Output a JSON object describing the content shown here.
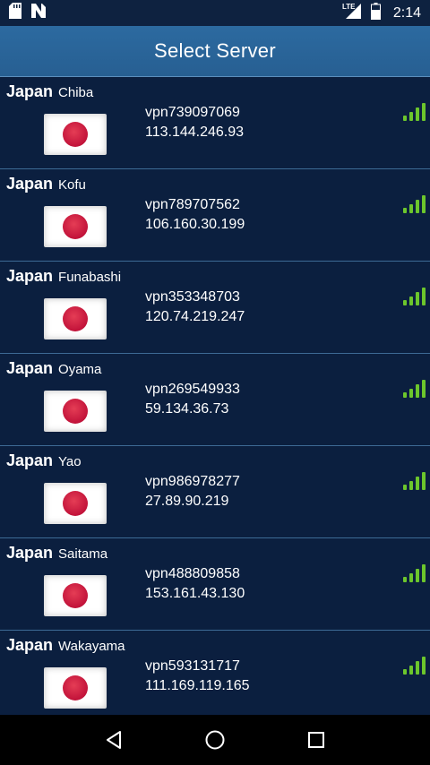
{
  "status_bar": {
    "time": "2:14",
    "left_icons": [
      "sd-card-icon",
      "n-notification-icon"
    ],
    "right_icons": [
      "lte-signal-icon",
      "battery-icon"
    ],
    "lte_label": "LTE"
  },
  "app_bar": {
    "title": "Select Server"
  },
  "servers": [
    {
      "country": "Japan",
      "city": "Chiba",
      "host": "vpn739097069",
      "ip": "113.144.246.93",
      "flag": "japan-flag-icon",
      "signal": "signal-full-icon"
    },
    {
      "country": "Japan",
      "city": "Kofu",
      "host": "vpn789707562",
      "ip": "106.160.30.199",
      "flag": "japan-flag-icon",
      "signal": "signal-full-icon"
    },
    {
      "country": "Japan",
      "city": "Funabashi",
      "host": "vpn353348703",
      "ip": "120.74.219.247",
      "flag": "japan-flag-icon",
      "signal": "signal-full-icon"
    },
    {
      "country": "Japan",
      "city": "Oyama",
      "host": "vpn269549933",
      "ip": "59.134.36.73",
      "flag": "japan-flag-icon",
      "signal": "signal-full-icon"
    },
    {
      "country": "Japan",
      "city": "Yao",
      "host": "vpn986978277",
      "ip": "27.89.90.219",
      "flag": "japan-flag-icon",
      "signal": "signal-full-icon"
    },
    {
      "country": "Japan",
      "city": "Saitama",
      "host": "vpn488809858",
      "ip": "153.161.43.130",
      "flag": "japan-flag-icon",
      "signal": "signal-full-icon"
    },
    {
      "country": "Japan",
      "city": "Wakayama",
      "host": "vpn593131717",
      "ip": "111.169.119.165",
      "flag": "japan-flag-icon",
      "signal": "signal-full-icon"
    }
  ],
  "nav_bar": {
    "icons": [
      "back-icon",
      "home-icon",
      "recents-icon"
    ]
  },
  "colors": {
    "background": "#0b1f3f",
    "app_bar": "#2c6aa0",
    "divider": "#3d6a95",
    "signal": "#6cc62c",
    "flag_disc": "#c2133a"
  }
}
